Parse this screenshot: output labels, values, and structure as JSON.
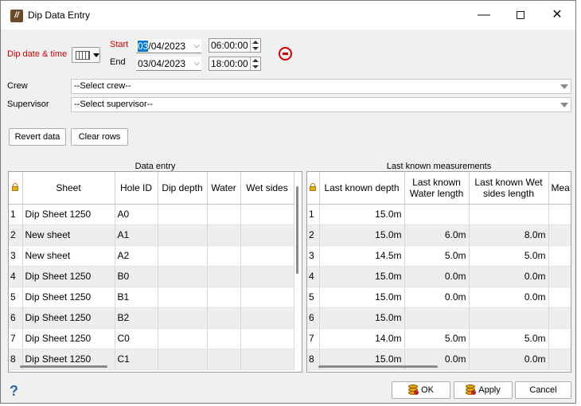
{
  "window": {
    "title": "Dip Data Entry",
    "app_icon": "app-logo-icon",
    "controls": {
      "minimize": "—",
      "close": "✕"
    }
  },
  "date_section": {
    "label": "Dip date & time",
    "start_label": "Start",
    "end_label": "End",
    "start_date_selected": "03",
    "start_date_rest": "/04/2023",
    "end_date": "03/04/2023",
    "start_time": "06:00:00",
    "end_time": "18:00:00"
  },
  "crew": {
    "label": "Crew",
    "value": "--Select crew--"
  },
  "supervisor": {
    "label": "Supervisor",
    "value": "--Select supervisor--"
  },
  "buttons": {
    "revert": "Revert data",
    "clear": "Clear rows",
    "ok": "OK",
    "apply": "Apply",
    "cancel": "Cancel"
  },
  "help_icon": "?",
  "data_entry": {
    "title": "Data entry",
    "columns": [
      "Sheet",
      "Hole ID",
      "Dip depth",
      "Water",
      "Wet sides"
    ],
    "rows": [
      {
        "n": "1",
        "sheet": "Dip Sheet 1250",
        "hole": "A0"
      },
      {
        "n": "2",
        "sheet": "New sheet",
        "hole": "A1"
      },
      {
        "n": "3",
        "sheet": "New sheet",
        "hole": "A2"
      },
      {
        "n": "4",
        "sheet": "Dip Sheet 1250",
        "hole": "B0"
      },
      {
        "n": "5",
        "sheet": "Dip Sheet 1250",
        "hole": "B1"
      },
      {
        "n": "6",
        "sheet": "Dip Sheet 1250",
        "hole": "B2"
      },
      {
        "n": "7",
        "sheet": "Dip Sheet 1250",
        "hole": "C0"
      },
      {
        "n": "8",
        "sheet": "Dip Sheet 1250",
        "hole": "C1"
      }
    ]
  },
  "last_known": {
    "title": "Last known measurements",
    "columns": [
      "Last known depth",
      "Last known Water length",
      "Last known Wet sides length",
      "Mea"
    ],
    "rows": [
      {
        "n": "1",
        "depth": "15.0m",
        "water": "",
        "wet": ""
      },
      {
        "n": "2",
        "depth": "15.0m",
        "water": "6.0m",
        "wet": "8.0m"
      },
      {
        "n": "3",
        "depth": "14.5m",
        "water": "5.0m",
        "wet": "5.0m"
      },
      {
        "n": "4",
        "depth": "15.0m",
        "water": "0.0m",
        "wet": "0.0m"
      },
      {
        "n": "5",
        "depth": "15.0m",
        "water": "0.0m",
        "wet": "0.0m"
      },
      {
        "n": "6",
        "depth": "15.0m",
        "water": "",
        "wet": ""
      },
      {
        "n": "7",
        "depth": "14.0m",
        "water": "5.0m",
        "wet": "5.0m"
      },
      {
        "n": "8",
        "depth": "15.0m",
        "water": "0.0m",
        "wet": "0.0m"
      }
    ]
  }
}
